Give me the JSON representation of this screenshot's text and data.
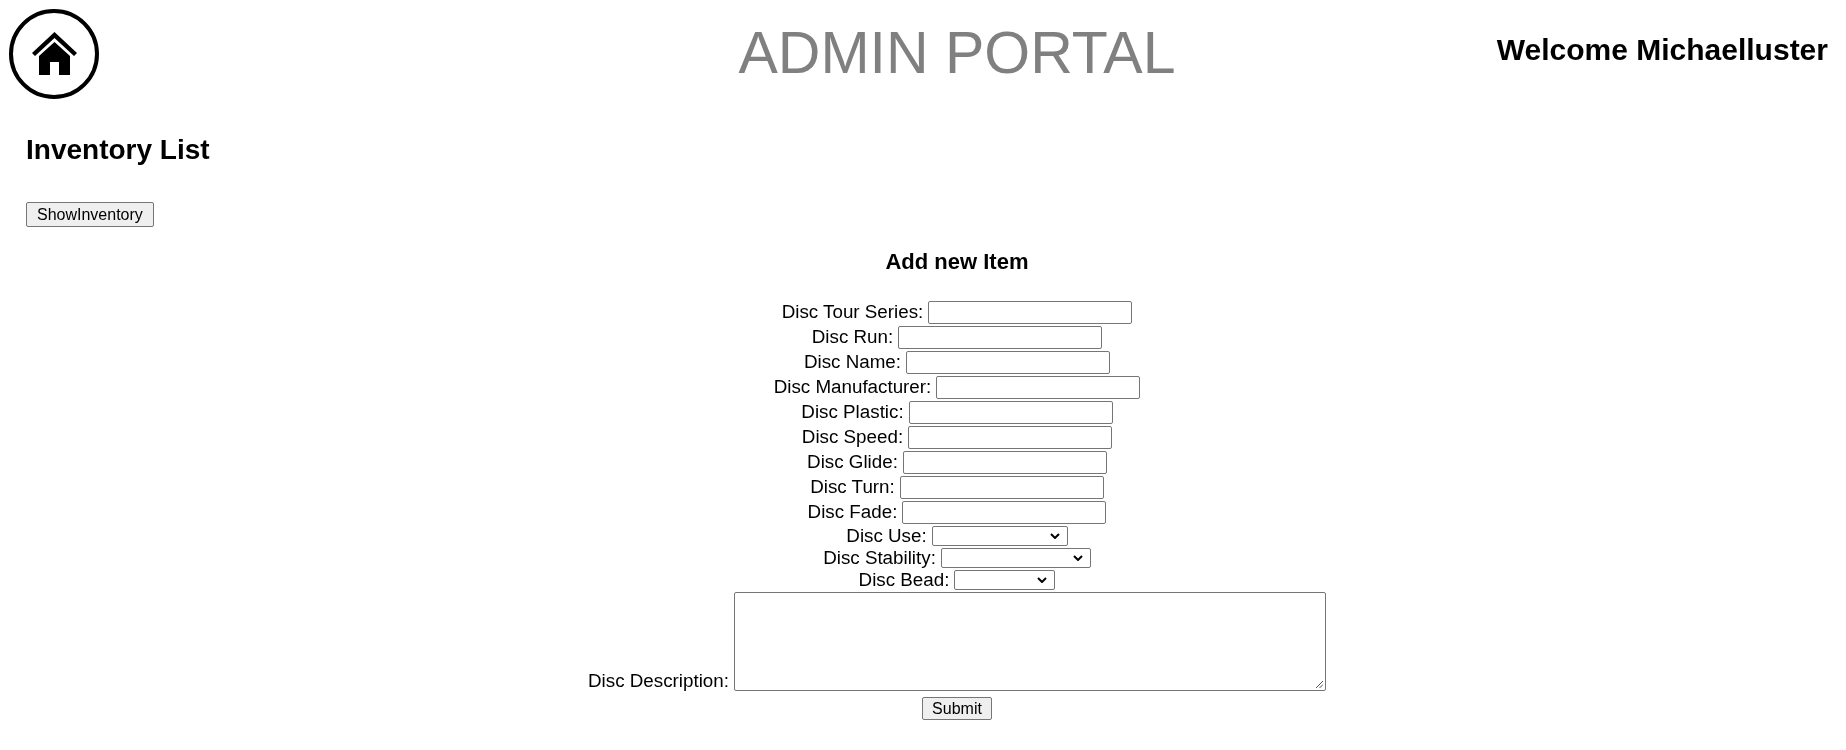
{
  "header": {
    "title": "ADMIN PORTAL",
    "welcome": "Welcome Michaelluster"
  },
  "inventory": {
    "heading": "Inventory List",
    "show_button": "ShowInventory"
  },
  "add_item_form": {
    "heading": "Add new Item",
    "fields": [
      {
        "label": "Disc Tour Series:",
        "kind": "text"
      },
      {
        "label": "Disc Run:",
        "kind": "text"
      },
      {
        "label": "Disc Name:",
        "kind": "text"
      },
      {
        "label": "Disc Manufacturer:",
        "kind": "text"
      },
      {
        "label": "Disc Plastic:",
        "kind": "text"
      },
      {
        "label": "Disc Speed:",
        "kind": "text"
      },
      {
        "label": "Disc Glide:",
        "kind": "text"
      },
      {
        "label": "Disc Turn:",
        "kind": "text"
      },
      {
        "label": "Disc Fade:",
        "kind": "text"
      },
      {
        "label": "Disc Use:",
        "kind": "select"
      },
      {
        "label": "Disc Stability:",
        "kind": "select"
      },
      {
        "label": "Disc Bead:",
        "kind": "select"
      },
      {
        "label": "Disc Description:",
        "kind": "textarea"
      }
    ],
    "submit_button": "Submit"
  }
}
